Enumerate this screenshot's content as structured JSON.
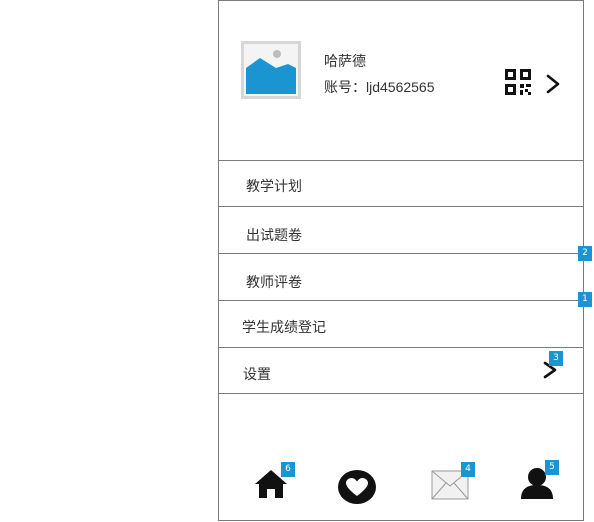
{
  "profile": {
    "name": "哈萨德",
    "account": "账号：ljd4562565",
    "avatar_icon": "image-placeholder-icon",
    "qr_icon": "qr-code-icon",
    "chevron_icon": "chevron-right-icon"
  },
  "menu": [
    {
      "label": "教学计划"
    },
    {
      "label": "出试题卷"
    },
    {
      "label": "教师评卷"
    },
    {
      "label": "学生成绩登记"
    },
    {
      "label": "设置"
    }
  ],
  "annotations": {
    "badge_paper": "2",
    "badge_grading": "1",
    "badge_settings": "3",
    "badge_home": "6",
    "badge_mail": "4",
    "badge_user": "5"
  },
  "footer": [
    {
      "icon": "home-icon"
    },
    {
      "icon": "heart-icon"
    },
    {
      "icon": "mail-icon"
    },
    {
      "icon": "user-icon"
    }
  ],
  "colors": {
    "accent": "#1a95d2",
    "border": "#7a7a7a",
    "icon": "#111111"
  }
}
